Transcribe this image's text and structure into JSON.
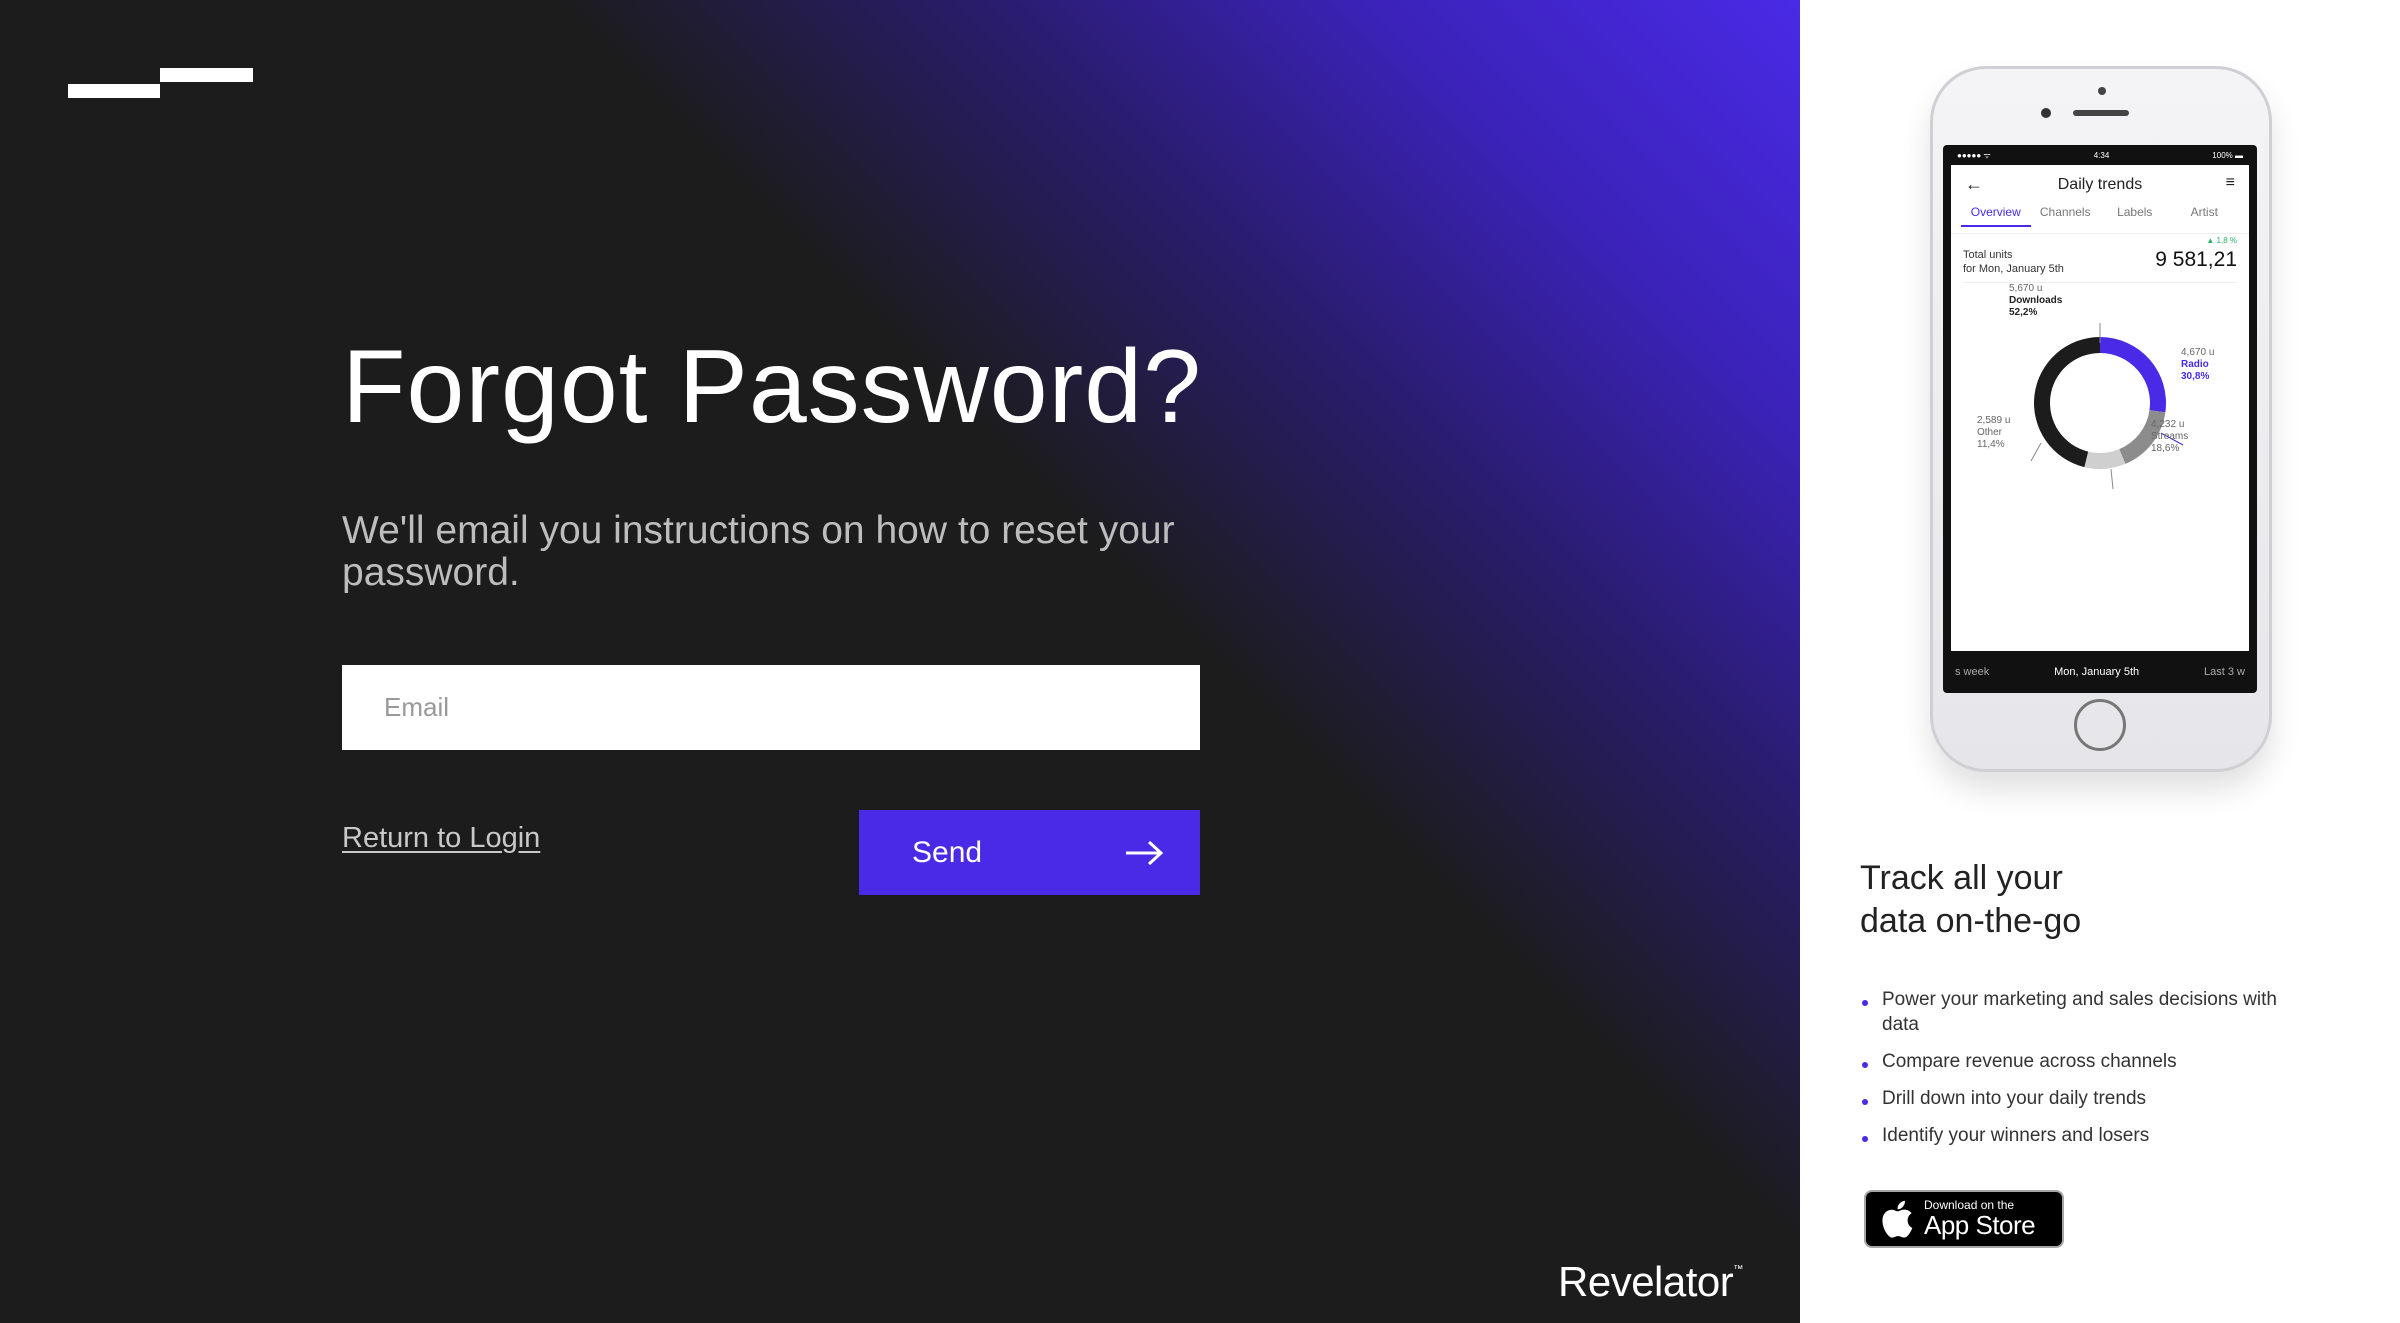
{
  "logo": {
    "name": "revelator-logo-mark"
  },
  "form": {
    "title": "Forgot Password?",
    "subtitle": "We'll email you instructions on how to reset your password.",
    "email_placeholder": "Email",
    "email_value": "",
    "return_label": "Return to Login",
    "send_label": "Send"
  },
  "brand": {
    "name": "Revelator",
    "tm": "™"
  },
  "phone": {
    "status": {
      "left": "●●●●● ᯤ",
      "time": "4:34",
      "right": "100% ▬"
    },
    "app_title": "Daily trends",
    "tabs": [
      "Overview",
      "Channels",
      "Labels",
      "Artist"
    ],
    "active_tab": "Overview",
    "total_label_1": "Total units",
    "total_label_2": "for Mon, January 5th",
    "total_value": "9 581,21",
    "change": "▲ 1,8 %",
    "segments": [
      {
        "value": "5,670",
        "unit": "u",
        "name": "Downloads",
        "pct": "52,2%",
        "share": 0.522,
        "color": "#1c1c1c"
      },
      {
        "value": "4,670",
        "unit": "u",
        "name": "Radio",
        "pct": "30,8%",
        "share": 0.308,
        "color": "#4a2ae6"
      },
      {
        "value": "4,232",
        "unit": "u",
        "name": "Streams",
        "pct": "18,6%",
        "share": 0.186,
        "color": "#8c8c8c"
      },
      {
        "value": "2,589",
        "unit": "u",
        "name": "Other",
        "pct": "11,4%",
        "share": 0.114,
        "color": "#cfcfcf"
      }
    ],
    "footer_left": "s week",
    "footer_mid": "Mon, January 5th",
    "footer_right": "Last 3 w"
  },
  "promo": {
    "title_line1": "Track all your",
    "title_line2": "data on-the-go",
    "bullets": [
      "Power your marketing and sales decisions with data",
      "Compare revenue across channels",
      "Drill down into your daily trends",
      "Identify your winners and losers"
    ],
    "appstore_small": "Download on the",
    "appstore_big": "App Store"
  },
  "colors": {
    "accent": "#4a2ae6",
    "dark_bg": "#1c1c1c",
    "muted_text": "#bdbdbd"
  }
}
